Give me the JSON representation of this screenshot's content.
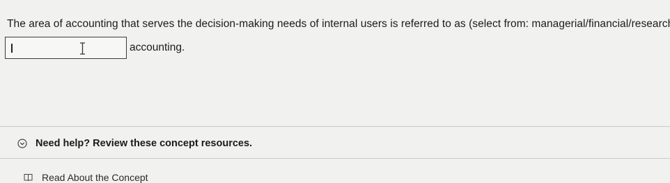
{
  "question": {
    "text": "The area of accounting that serves the decision-making needs of internal users is referred to as (select from: managerial/financial/research)",
    "answer_value": "",
    "answer_suffix": "accounting."
  },
  "help": {
    "toggle_label": "Need help? Review these concept resources.",
    "resources": [
      {
        "label": "Read About the Concept",
        "icon": "book-icon"
      }
    ]
  },
  "icons": {
    "toggle": "chevron-down-circle-icon",
    "cursor": "text-cursor-icon"
  },
  "colors": {
    "background": "#f1f1ef",
    "text": "#1b1b1b",
    "divider": "#c9c9c6"
  }
}
